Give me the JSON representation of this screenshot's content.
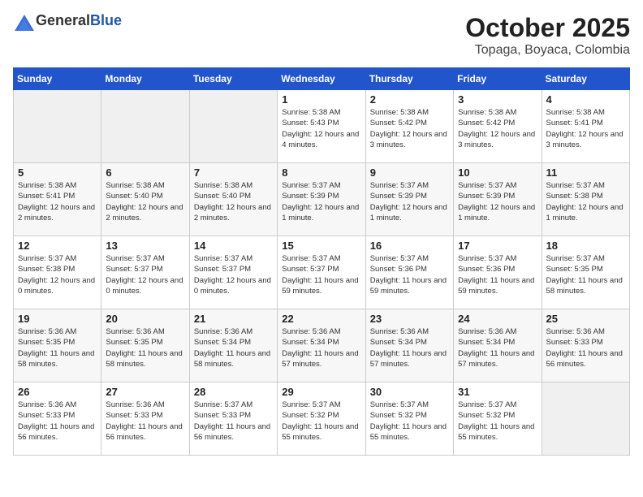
{
  "header": {
    "logo_general": "General",
    "logo_blue": "Blue",
    "title": "October 2025",
    "subtitle": "Topaga, Boyaca, Colombia"
  },
  "weekdays": [
    "Sunday",
    "Monday",
    "Tuesday",
    "Wednesday",
    "Thursday",
    "Friday",
    "Saturday"
  ],
  "weeks": [
    [
      {
        "day": "",
        "empty": true
      },
      {
        "day": "",
        "empty": true
      },
      {
        "day": "",
        "empty": true
      },
      {
        "day": "1",
        "sunrise": "Sunrise: 5:38 AM",
        "sunset": "Sunset: 5:43 PM",
        "daylight": "Daylight: 12 hours and 4 minutes."
      },
      {
        "day": "2",
        "sunrise": "Sunrise: 5:38 AM",
        "sunset": "Sunset: 5:42 PM",
        "daylight": "Daylight: 12 hours and 3 minutes."
      },
      {
        "day": "3",
        "sunrise": "Sunrise: 5:38 AM",
        "sunset": "Sunset: 5:42 PM",
        "daylight": "Daylight: 12 hours and 3 minutes."
      },
      {
        "day": "4",
        "sunrise": "Sunrise: 5:38 AM",
        "sunset": "Sunset: 5:41 PM",
        "daylight": "Daylight: 12 hours and 3 minutes."
      }
    ],
    [
      {
        "day": "5",
        "sunrise": "Sunrise: 5:38 AM",
        "sunset": "Sunset: 5:41 PM",
        "daylight": "Daylight: 12 hours and 2 minutes."
      },
      {
        "day": "6",
        "sunrise": "Sunrise: 5:38 AM",
        "sunset": "Sunset: 5:40 PM",
        "daylight": "Daylight: 12 hours and 2 minutes."
      },
      {
        "day": "7",
        "sunrise": "Sunrise: 5:38 AM",
        "sunset": "Sunset: 5:40 PM",
        "daylight": "Daylight: 12 hours and 2 minutes."
      },
      {
        "day": "8",
        "sunrise": "Sunrise: 5:37 AM",
        "sunset": "Sunset: 5:39 PM",
        "daylight": "Daylight: 12 hours and 1 minute."
      },
      {
        "day": "9",
        "sunrise": "Sunrise: 5:37 AM",
        "sunset": "Sunset: 5:39 PM",
        "daylight": "Daylight: 12 hours and 1 minute."
      },
      {
        "day": "10",
        "sunrise": "Sunrise: 5:37 AM",
        "sunset": "Sunset: 5:39 PM",
        "daylight": "Daylight: 12 hours and 1 minute."
      },
      {
        "day": "11",
        "sunrise": "Sunrise: 5:37 AM",
        "sunset": "Sunset: 5:38 PM",
        "daylight": "Daylight: 12 hours and 1 minute."
      }
    ],
    [
      {
        "day": "12",
        "sunrise": "Sunrise: 5:37 AM",
        "sunset": "Sunset: 5:38 PM",
        "daylight": "Daylight: 12 hours and 0 minutes."
      },
      {
        "day": "13",
        "sunrise": "Sunrise: 5:37 AM",
        "sunset": "Sunset: 5:37 PM",
        "daylight": "Daylight: 12 hours and 0 minutes."
      },
      {
        "day": "14",
        "sunrise": "Sunrise: 5:37 AM",
        "sunset": "Sunset: 5:37 PM",
        "daylight": "Daylight: 12 hours and 0 minutes."
      },
      {
        "day": "15",
        "sunrise": "Sunrise: 5:37 AM",
        "sunset": "Sunset: 5:37 PM",
        "daylight": "Daylight: 11 hours and 59 minutes."
      },
      {
        "day": "16",
        "sunrise": "Sunrise: 5:37 AM",
        "sunset": "Sunset: 5:36 PM",
        "daylight": "Daylight: 11 hours and 59 minutes."
      },
      {
        "day": "17",
        "sunrise": "Sunrise: 5:37 AM",
        "sunset": "Sunset: 5:36 PM",
        "daylight": "Daylight: 11 hours and 59 minutes."
      },
      {
        "day": "18",
        "sunrise": "Sunrise: 5:37 AM",
        "sunset": "Sunset: 5:35 PM",
        "daylight": "Daylight: 11 hours and 58 minutes."
      }
    ],
    [
      {
        "day": "19",
        "sunrise": "Sunrise: 5:36 AM",
        "sunset": "Sunset: 5:35 PM",
        "daylight": "Daylight: 11 hours and 58 minutes."
      },
      {
        "day": "20",
        "sunrise": "Sunrise: 5:36 AM",
        "sunset": "Sunset: 5:35 PM",
        "daylight": "Daylight: 11 hours and 58 minutes."
      },
      {
        "day": "21",
        "sunrise": "Sunrise: 5:36 AM",
        "sunset": "Sunset: 5:34 PM",
        "daylight": "Daylight: 11 hours and 58 minutes."
      },
      {
        "day": "22",
        "sunrise": "Sunrise: 5:36 AM",
        "sunset": "Sunset: 5:34 PM",
        "daylight": "Daylight: 11 hours and 57 minutes."
      },
      {
        "day": "23",
        "sunrise": "Sunrise: 5:36 AM",
        "sunset": "Sunset: 5:34 PM",
        "daylight": "Daylight: 11 hours and 57 minutes."
      },
      {
        "day": "24",
        "sunrise": "Sunrise: 5:36 AM",
        "sunset": "Sunset: 5:34 PM",
        "daylight": "Daylight: 11 hours and 57 minutes."
      },
      {
        "day": "25",
        "sunrise": "Sunrise: 5:36 AM",
        "sunset": "Sunset: 5:33 PM",
        "daylight": "Daylight: 11 hours and 56 minutes."
      }
    ],
    [
      {
        "day": "26",
        "sunrise": "Sunrise: 5:36 AM",
        "sunset": "Sunset: 5:33 PM",
        "daylight": "Daylight: 11 hours and 56 minutes."
      },
      {
        "day": "27",
        "sunrise": "Sunrise: 5:36 AM",
        "sunset": "Sunset: 5:33 PM",
        "daylight": "Daylight: 11 hours and 56 minutes."
      },
      {
        "day": "28",
        "sunrise": "Sunrise: 5:37 AM",
        "sunset": "Sunset: 5:33 PM",
        "daylight": "Daylight: 11 hours and 56 minutes."
      },
      {
        "day": "29",
        "sunrise": "Sunrise: 5:37 AM",
        "sunset": "Sunset: 5:32 PM",
        "daylight": "Daylight: 11 hours and 55 minutes."
      },
      {
        "day": "30",
        "sunrise": "Sunrise: 5:37 AM",
        "sunset": "Sunset: 5:32 PM",
        "daylight": "Daylight: 11 hours and 55 minutes."
      },
      {
        "day": "31",
        "sunrise": "Sunrise: 5:37 AM",
        "sunset": "Sunset: 5:32 PM",
        "daylight": "Daylight: 11 hours and 55 minutes."
      },
      {
        "day": "",
        "empty": true
      }
    ]
  ]
}
